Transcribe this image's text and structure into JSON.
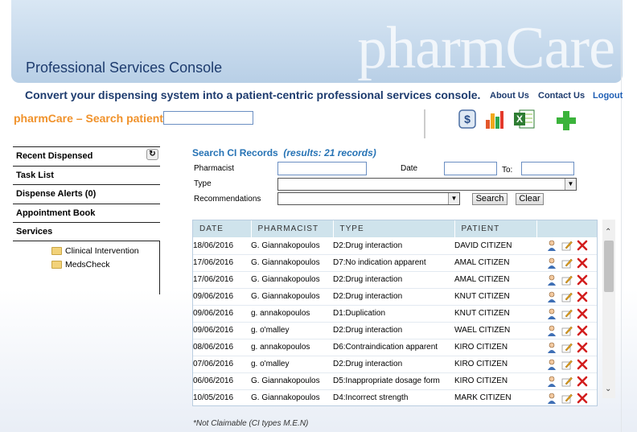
{
  "header": {
    "brand": "pharmCare",
    "console_title": "Professional Services Console",
    "tagline": "Convert your dispensing system into a patient-centric professional services console.",
    "links": [
      "About Us",
      "Contact Us",
      "Logout"
    ]
  },
  "search": {
    "label": "pharmCare – Search patient:",
    "value": ""
  },
  "toolbar": {
    "tools": [
      {
        "name": "dollar-icon"
      },
      {
        "name": "bar-chart-icon"
      },
      {
        "name": "excel-icon"
      },
      {
        "name": "plus-icon"
      }
    ]
  },
  "sidebar": {
    "items": [
      {
        "label": "Recent Dispensed"
      },
      {
        "label": "Task List"
      },
      {
        "label": "Dispense Alerts (0)"
      },
      {
        "label": "Appointment Book"
      },
      {
        "label": "Services"
      }
    ],
    "services": [
      {
        "label": "Clinical Intervention"
      },
      {
        "label": "MedsCheck"
      }
    ]
  },
  "ci": {
    "title": "Search CI Records",
    "count": "(results: 21 records)",
    "filters": {
      "pharmacist_label": "Pharmacist",
      "date_label": "Date",
      "to_label": "To:",
      "type_label": "Type",
      "recommendations_label": "Recommendations",
      "search_button": "Search",
      "clear_button": "Clear"
    },
    "columns": [
      "DATE",
      "PHARMACIST",
      "TYPE",
      "PATIENT"
    ],
    "rows": [
      {
        "date": "18/06/2016",
        "pharmacist": "G. Giannakopoulos",
        "type": "D2:Drug interaction",
        "patient": "DAVID CITIZEN"
      },
      {
        "date": "17/06/2016",
        "pharmacist": "G. Giannakopoulos",
        "type": "D7:No indication apparent",
        "patient": "AMAL CITIZEN"
      },
      {
        "date": "17/06/2016",
        "pharmacist": "G. Giannakopoulos",
        "type": "D2:Drug interaction",
        "patient": "AMAL CITIZEN"
      },
      {
        "date": "09/06/2016",
        "pharmacist": "G. Giannakopoulos",
        "type": "D2:Drug interaction",
        "patient": "KNUT CITIZEN"
      },
      {
        "date": "09/06/2016",
        "pharmacist": "g. annakopoulos",
        "type": "D1:Duplication",
        "patient": "KNUT CITIZEN"
      },
      {
        "date": "09/06/2016",
        "pharmacist": "g. o'malley",
        "type": "D2:Drug interaction",
        "patient": "WAEL CITIZEN"
      },
      {
        "date": "08/06/2016",
        "pharmacist": "g. annakopoulos",
        "type": "D6:Contraindication apparent",
        "patient": "KIRO CITIZEN"
      },
      {
        "date": "07/06/2016",
        "pharmacist": "g. o'malley",
        "type": "D2:Drug interaction",
        "patient": "KIRO CITIZEN"
      },
      {
        "date": "06/06/2016",
        "pharmacist": "G. Giannakopoulos",
        "type": "D5:Inappropriate dosage form",
        "patient": "KIRO CITIZEN"
      },
      {
        "date": "10/05/2016",
        "pharmacist": "G. Giannakopoulos",
        "type": "D4:Incorrect strength",
        "patient": "MARK CITIZEN"
      }
    ],
    "footnote": "*Not Claimable (CI types M.E.N)"
  },
  "colors": {
    "accent_orange": "#f0922b",
    "title_blue": "#2673b5",
    "header_navy": "#1d3b6e",
    "table_header": "#cfe3ec"
  }
}
